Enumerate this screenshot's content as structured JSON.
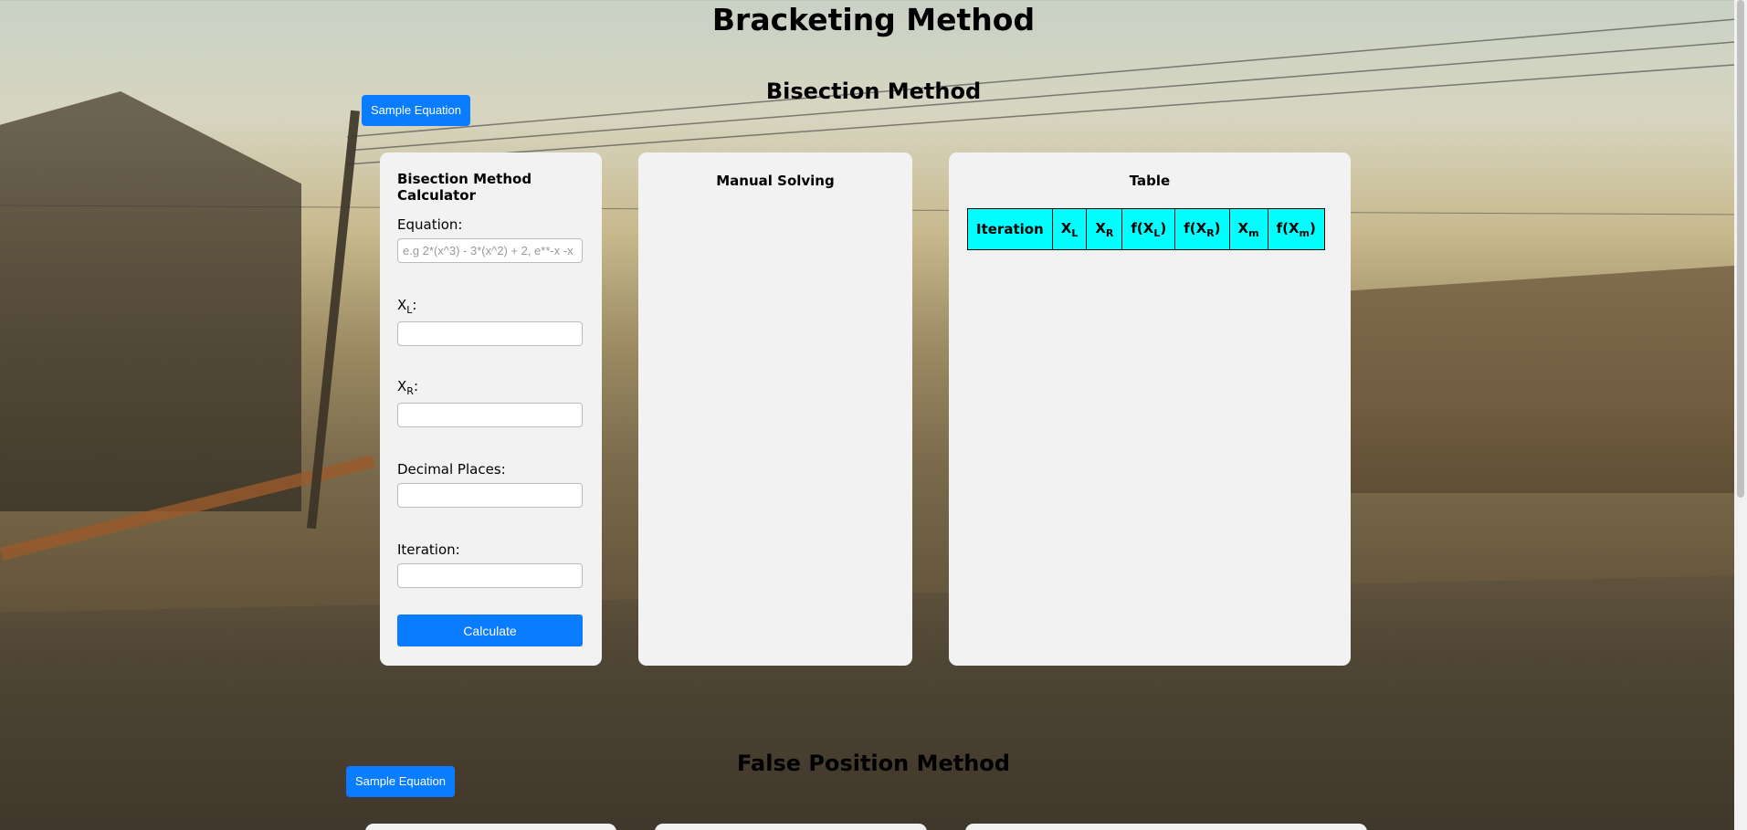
{
  "page_title": "Bracketing Method",
  "bisection": {
    "section_title": "Bisection Method",
    "sample_button": "Sample Equation",
    "calculator": {
      "title": "Bisection Method Calculator",
      "equation_label": "Equation:",
      "equation_placeholder": "e.g 2*(x^3) - 3*(x^2) + 2, e**-x -x",
      "xl_label": "X",
      "xl_sub": "L",
      "xr_label": "X",
      "xr_sub": "R",
      "colon": ":",
      "decimal_label": "Decimal Places:",
      "iteration_label": "Iteration:",
      "calculate_button": "Calculate"
    },
    "manual": {
      "title": "Manual Solving"
    },
    "table": {
      "title": "Table",
      "headers": [
        {
          "base": "Iteration",
          "sub": "",
          "suffix": ""
        },
        {
          "base": "X",
          "sub": "L",
          "suffix": ""
        },
        {
          "base": "X",
          "sub": "R",
          "suffix": ""
        },
        {
          "base": "f(X",
          "sub": "L",
          "suffix": ")"
        },
        {
          "base": "f(X",
          "sub": "R",
          "suffix": ")"
        },
        {
          "base": "X",
          "sub": "m",
          "suffix": ""
        },
        {
          "base": "f(X",
          "sub": "m",
          "suffix": ")"
        }
      ]
    }
  },
  "false_position": {
    "section_title": "False Position Method",
    "sample_button": "Sample Equation"
  },
  "colors": {
    "button": "#0a7cff",
    "panel": "#f2f2f2",
    "table_header": "#00ffff"
  }
}
